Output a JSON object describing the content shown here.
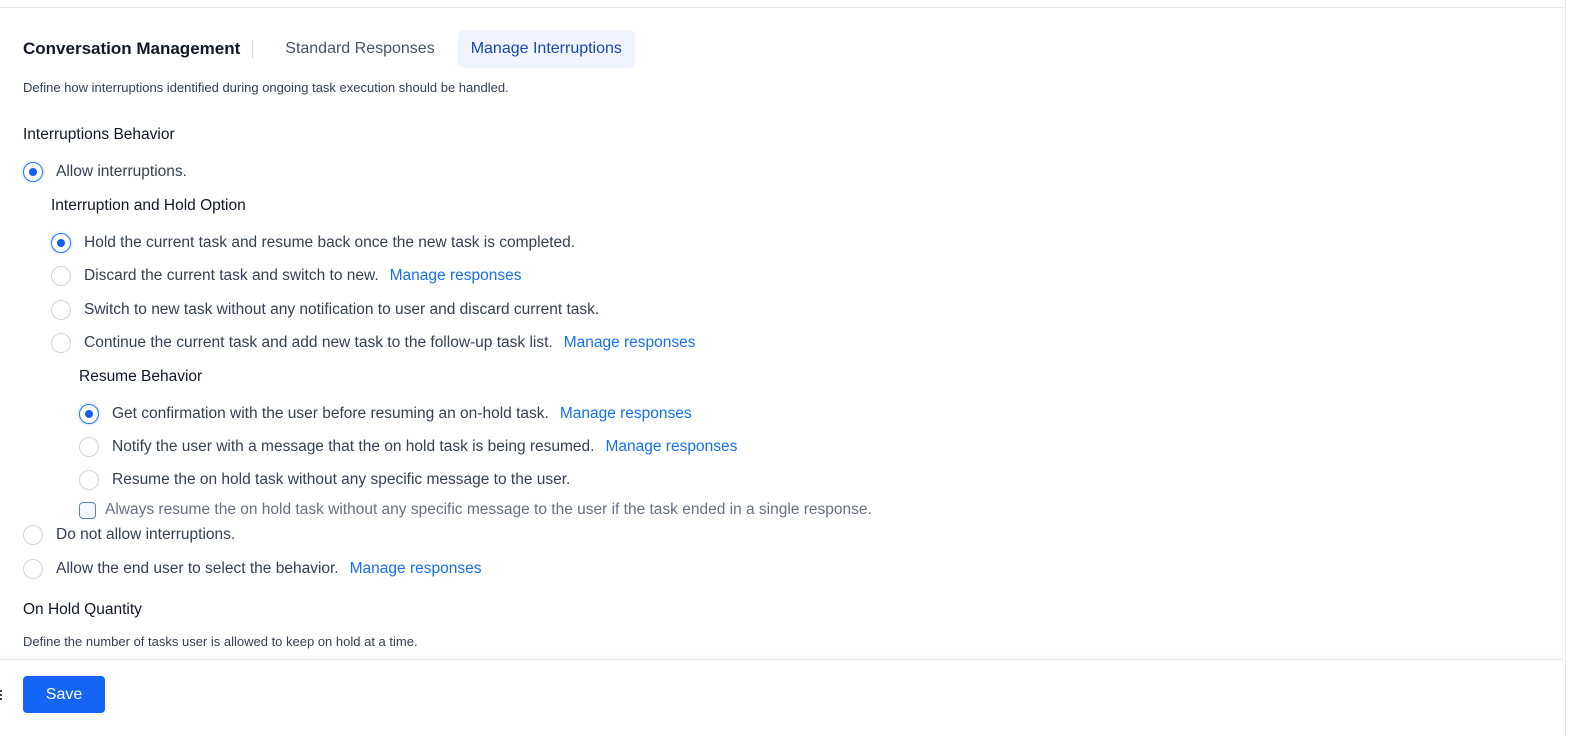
{
  "header": {
    "title": "Conversation Management",
    "tabs": [
      {
        "label": "Standard Responses",
        "active": false
      },
      {
        "label": "Manage Interruptions",
        "active": true
      }
    ]
  },
  "description": "Define how interruptions identified during ongoing task execution should be handled.",
  "interruptions_behavior": {
    "heading": "Interruptions Behavior",
    "allow": "Allow interruptions.",
    "hold_option": {
      "heading": "Interruption and Hold Option",
      "options": [
        {
          "label": "Hold the current task and resume back once the new task is completed.",
          "selected": true
        },
        {
          "label": "Discard the current task and switch to new.",
          "link": "Manage responses",
          "selected": false
        },
        {
          "label": "Switch to new task without any notification to user and discard current task.",
          "selected": false
        },
        {
          "label": "Continue the current task and add new task to the follow-up task list.",
          "link": "Manage responses",
          "selected": false
        }
      ]
    },
    "resume_behavior": {
      "heading": "Resume Behavior",
      "options": [
        {
          "label": "Get confirmation with the user before resuming an on-hold task.",
          "link": "Manage responses",
          "selected": true
        },
        {
          "label": "Notify the user with a message that the on hold task is being resumed.",
          "link": "Manage responses",
          "selected": false
        },
        {
          "label": "Resume the on hold task without any specific message to the user.",
          "selected": false
        }
      ],
      "checkbox": {
        "label": "Always resume the on hold task without any specific message to the user if the task ended in a single response.",
        "checked": false
      }
    },
    "do_not_allow": "Do not allow interruptions.",
    "allow_end_user": "Allow the end user to select the behavior.",
    "allow_end_user_link": "Manage responses"
  },
  "on_hold": {
    "heading": "On Hold Quantity",
    "description": "Define the number of tasks user is allowed to keep on hold at a time."
  },
  "footer": {
    "save_label": "Save"
  },
  "colors": {
    "accent": "#1464f6",
    "link": "#1570ef",
    "active_tab_bg": "#eff4ff"
  }
}
